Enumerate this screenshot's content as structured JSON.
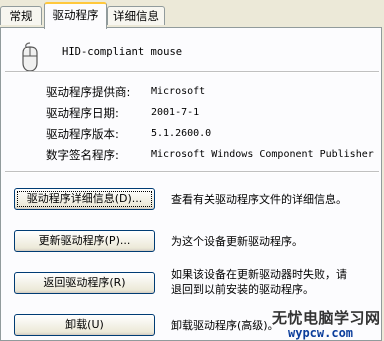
{
  "tabs": [
    {
      "label": "常规"
    },
    {
      "label": "驱动程序"
    },
    {
      "label": "详细信息"
    }
  ],
  "device": {
    "name": "HID-compliant mouse",
    "icon": "mouse-icon"
  },
  "properties": [
    {
      "label": "驱动程序提供商:",
      "value": "Microsoft"
    },
    {
      "label": "驱动程序日期:",
      "value": "2001-7-1"
    },
    {
      "label": "驱动程序版本:",
      "value": "5.1.2600.0"
    },
    {
      "label": "数字签名程序:",
      "value": "Microsoft Windows Component Publisher"
    }
  ],
  "actions": [
    {
      "button": "驱动程序详细信息(D)...",
      "description": "查看有关驱动程序文件的详细信息。"
    },
    {
      "button": "更新驱动程序(P)...",
      "description": "为这个设备更新驱动程序。"
    },
    {
      "button": "返回驱动程序(R)",
      "description_line1": "如果该设备在更新驱动器时失败，请",
      "description_line2": "退回到以前安装的驱动程序。"
    },
    {
      "button": "卸载(U)",
      "description": "卸载驱动程序(高级)。"
    }
  ],
  "watermark": {
    "line1": "无忧电脑学习网",
    "line2": "wypcw.com"
  },
  "colors": {
    "tab_highlight": "#ffc83c",
    "button_border": "#003c74",
    "panel_bg": "#fcfcfe",
    "window_bg": "#ece9d8"
  }
}
